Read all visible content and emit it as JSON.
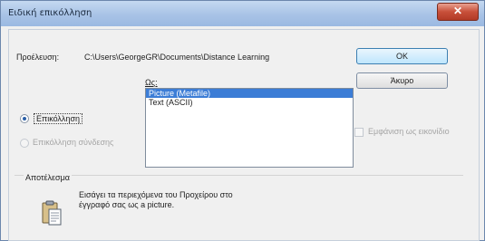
{
  "window": {
    "title": "Ειδική επικόλληση",
    "close_glyph": "✕"
  },
  "source": {
    "label": "Προέλευση:",
    "path": "C:\\Users\\GeorgeGR\\Documents\\Distance Learning"
  },
  "as_label": "Ως:",
  "options": {
    "paste_label": "Επικόλληση",
    "paste_link_label": "Επικόλληση σύνδεσης"
  },
  "formats": [
    "Picture (Metafile)",
    "Text (ASCII)"
  ],
  "buttons": {
    "ok": "OK",
    "cancel": "Άκυρο"
  },
  "display_as_icon_label": "Εμφάνιση ως εικονίδιο",
  "result": {
    "title": "Αποτέλεσμα",
    "text": "Εισάγει τα περιεχόμενα του Προχείρου στο έγγραφό σας ως a picture."
  },
  "icons": {
    "close": "close-icon",
    "result": "clipboard-paste-icon"
  }
}
